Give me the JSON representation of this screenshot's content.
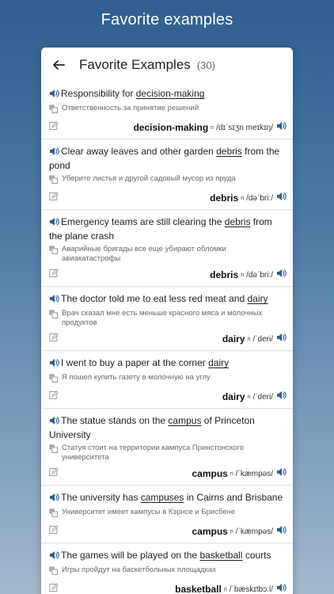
{
  "banner": "Favorite examples",
  "appbar": {
    "title": "Favorite Examples",
    "count": "(30)"
  },
  "colors": {
    "speaker": "#2f5f8f",
    "edit": "#9a9fa6"
  },
  "items": [
    {
      "pre": "Responsibility for ",
      "hl": "decision-making",
      "post": "",
      "tr": "Ответственность за принятие решений",
      "word": "decision-making",
      "pos": "n",
      "ipa": "/dɪˈsɪʒn meɪkɪŋ/"
    },
    {
      "pre": "Clear away leaves and other garden ",
      "hl": "debris",
      "post": " from the pond",
      "tr": "Уберите листья и другой садовый мусор из пруда",
      "word": "debris",
      "pos": "n",
      "ipa": "/dəˈbriː/"
    },
    {
      "pre": "Emergency teams are still clearing the ",
      "hl": "debris",
      "post": " from the plane crash",
      "tr": "Аварийные бригады все еще убирают обломки авиакатастрофы",
      "word": "debris",
      "pos": "n",
      "ipa": "/dəˈbriː/"
    },
    {
      "pre": "The doctor told me to eat less red meat and ",
      "hl": "dairy",
      "post": "",
      "tr": "Врач сказал мне есть меньше красного мяса и молочных продуктов",
      "word": "dairy",
      "pos": "n",
      "ipa": "/ˈderi/"
    },
    {
      "pre": "I went to buy a paper at the corner ",
      "hl": "dairy",
      "post": "",
      "tr": "Я пошел купить газету в молочную на углу",
      "word": "dairy",
      "pos": "n",
      "ipa": "/ˈderi/"
    },
    {
      "pre": "The statue stands on the ",
      "hl": "campus",
      "post": " of Princeton University",
      "tr": "Статуя стоит на территории кампуса Принстонского университета",
      "word": "campus",
      "pos": "n",
      "ipa": "/ˈkæmpəs/"
    },
    {
      "pre": "The university has ",
      "hl": "campuses",
      "post": " in Cairns and Brisbane",
      "tr": "Университет имеет кампусы в Кэрнсе и Брисбене",
      "word": "campus",
      "pos": "n",
      "ipa": "/ˈkæmpəs/"
    },
    {
      "pre": "The games will be played on the ",
      "hl": "basketball",
      "post": " courts",
      "tr": "Игры пройдут на баскетбольных площадках",
      "word": "basketball",
      "pos": "n",
      "ipa": "/ˈbæskɪtbɔːl/"
    }
  ]
}
